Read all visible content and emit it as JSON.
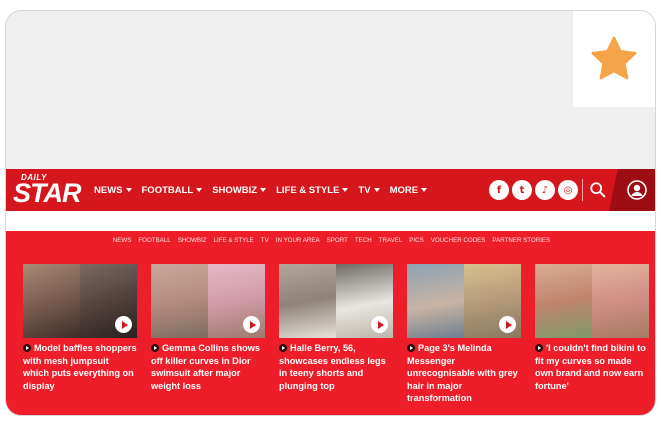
{
  "brand": {
    "logo_top": "DAILY",
    "logo_main": "STAR"
  },
  "main_menu": [
    {
      "label": "NEWS"
    },
    {
      "label": "FOOTBALL"
    },
    {
      "label": "SHOWBIZ"
    },
    {
      "label": "LIFE & STYLE"
    },
    {
      "label": "TV"
    },
    {
      "label": "MORE"
    }
  ],
  "socials": [
    {
      "icon": "facebook-icon",
      "glyph": "f"
    },
    {
      "icon": "twitter-icon",
      "glyph": "t"
    },
    {
      "icon": "tiktok-icon",
      "glyph": "♪"
    },
    {
      "icon": "instagram-icon",
      "glyph": "◎"
    }
  ],
  "sub_menu": [
    "NEWS",
    "FOOTBALL",
    "SHOWBIZ",
    "LIFE & STYLE",
    "TV",
    "IN YOUR AREA",
    "SPORT",
    "TECH",
    "TRAVEL",
    "PICS",
    "VOUCHER CODES",
    "PARTNER STORIES"
  ],
  "articles": [
    {
      "headline": "Model baffles shoppers with mesh jumpsuit which puts everything on display",
      "img_a": "#8a6a58",
      "img_b": "#5b4a44"
    },
    {
      "headline": "Gemma Collins shows off killer curves in Dior swimsuit after major weight loss",
      "img_a": "#b98f86",
      "img_b": "#d9a8b4"
    },
    {
      "headline": "Halle Berry, 56, showcases endless legs in teeny shorts and plunging top",
      "img_a": "#9a8f86",
      "img_b": "#c8c2b8"
    },
    {
      "headline": "Page 3's Melinda Messenger unrecognisable with grey hair in major transformation",
      "img_a": "#7d8fa0",
      "img_b": "#b7a27e"
    },
    {
      "headline": "'I couldn't find bikini to fit my curves so made own brand and now earn fortune'",
      "img_a": "#c79a84",
      "img_b": "#d8a395"
    }
  ],
  "colors": {
    "brand_red": "#d5161d",
    "content_red": "#ee1d2a",
    "star": "#f6a44a"
  }
}
